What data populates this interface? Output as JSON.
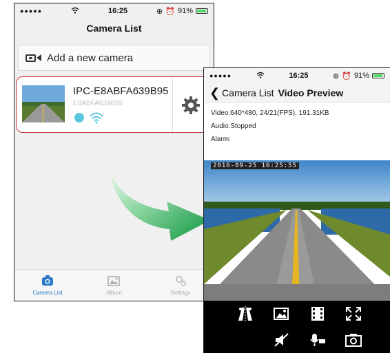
{
  "phone1": {
    "status": {
      "signal": "●●●●●",
      "time": "16:25",
      "battery": "91%"
    },
    "nav_title": "Camera List",
    "add_camera_label": "Add a new camera",
    "camera": {
      "name": "IPC-E8ABFA639B95",
      "id": "E8ABFA639B95"
    },
    "tabs": [
      {
        "label": "Camera List",
        "icon": "camera-icon"
      },
      {
        "label": "Album",
        "icon": "photo-icon"
      },
      {
        "label": "Settings",
        "icon": "gear-icon"
      }
    ]
  },
  "phone2": {
    "status": {
      "signal": "●●●●●",
      "time": "16:25",
      "battery": "91%"
    },
    "back_label": "Camera List",
    "nav_title": "Video Preview",
    "video_info": "Video:640*480, 24/21(FPS), 191.31KB",
    "audio_info": "Audio:Stopped",
    "alarm_info": "Alarm:",
    "timestamp": "2016-09-25 16:25:55",
    "controls_row1": [
      "mirror-icon",
      "image-icon",
      "video-record-icon",
      "fullscreen-icon"
    ],
    "controls_row2": [
      "mute-icon",
      "talk-icon",
      "snapshot-icon"
    ]
  },
  "colors": {
    "accent": "#2a78c8",
    "highlight_border": "#c8343b",
    "arrow": "#1a9c4a",
    "online": "#5cc8e0"
  }
}
